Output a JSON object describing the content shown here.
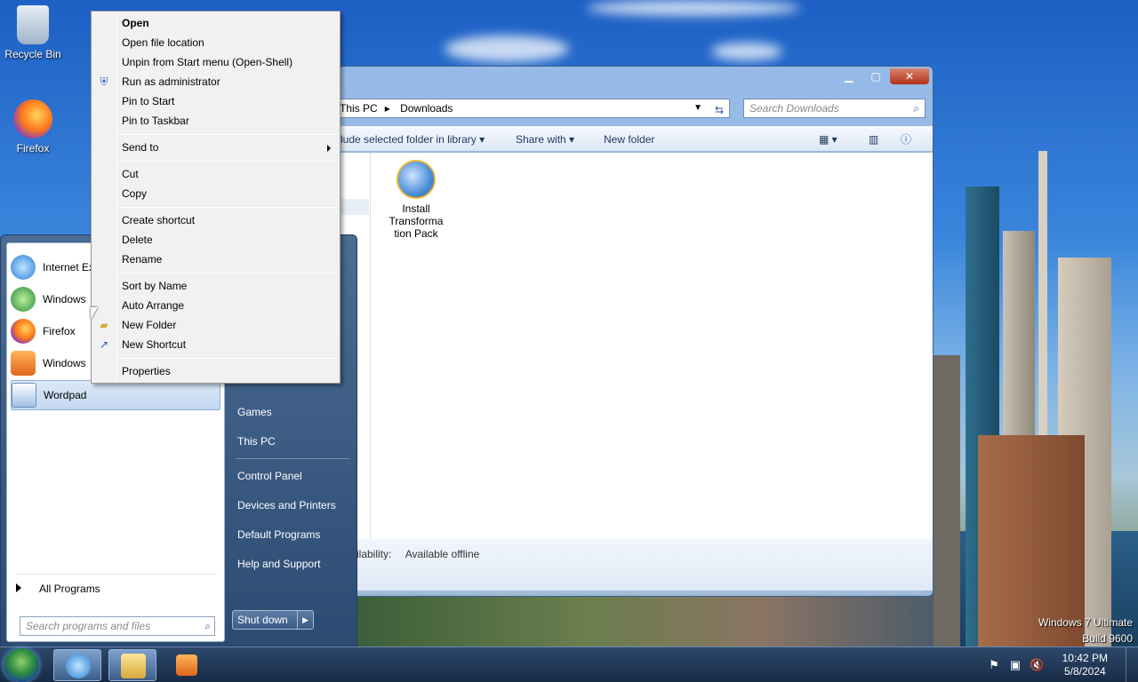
{
  "desktop": {
    "icons": [
      {
        "label": "Recycle Bin",
        "icon": "recycle-bin-icon"
      },
      {
        "label": "Firefox",
        "icon": "firefox-icon"
      }
    ],
    "watermark": {
      "line1": "Windows 7 Ultimate",
      "line2": "Build 9600"
    }
  },
  "explorer": {
    "title_buttons": {
      "minimize": "▁",
      "maximize": "▢",
      "close": "✕"
    },
    "breadcrumb": [
      "This PC",
      "Downloads"
    ],
    "search_placeholder": "Search Downloads",
    "commands": {
      "include": "lude selected folder in library",
      "share": "Share with",
      "new_folder": "New folder"
    },
    "file": {
      "label_lines": [
        "Install",
        "Transforma",
        "tion Pack"
      ]
    },
    "details": {
      "label": "ilability:",
      "value": "Available offline"
    }
  },
  "start_menu": {
    "pinned": [
      {
        "label": "Internet Ex",
        "icon": "internet-explorer-icon"
      },
      {
        "label": "Windows",
        "icon": "windows-media-center-icon"
      },
      {
        "label": "Firefox",
        "icon": "firefox-icon"
      },
      {
        "label": "Windows",
        "icon": "windows-media-player-icon"
      },
      {
        "label": "Wordpad",
        "icon": "wordpad-icon"
      }
    ],
    "all_programs": "All Programs",
    "search_placeholder": "Search programs and files",
    "right_links": [
      "Games",
      "This PC",
      "Control Panel",
      "Devices and Printers",
      "Default Programs",
      "Help and Support"
    ],
    "shutdown": "Shut down"
  },
  "context_menu": {
    "items": [
      {
        "label": "Open",
        "bold": true
      },
      {
        "label": "Open file location"
      },
      {
        "label": "Unpin from Start menu (Open-Shell)"
      },
      {
        "label": "Run as administrator",
        "icon": "uac-shield-icon"
      },
      {
        "label": "Pin to Start"
      },
      {
        "label": "Pin to Taskbar"
      },
      {
        "label": "Send to",
        "submenu": true
      },
      {
        "label": "Cut"
      },
      {
        "label": "Copy"
      },
      {
        "label": "Create shortcut"
      },
      {
        "label": "Delete"
      },
      {
        "label": "Rename"
      },
      {
        "label": "Sort by Name"
      },
      {
        "label": "Auto Arrange"
      },
      {
        "label": "New Folder",
        "icon": "folder-icon"
      },
      {
        "label": "New Shortcut",
        "icon": "shortcut-icon"
      },
      {
        "label": "Properties"
      }
    ]
  },
  "taskbar": {
    "apps": [
      {
        "name": "internet-explorer",
        "icon": "internet-explorer-icon"
      },
      {
        "name": "file-explorer",
        "icon": "folder-icon"
      },
      {
        "name": "media-player",
        "icon": "media-player-icon"
      }
    ],
    "clock": {
      "time": "10:42 PM",
      "date": "5/8/2024"
    }
  }
}
